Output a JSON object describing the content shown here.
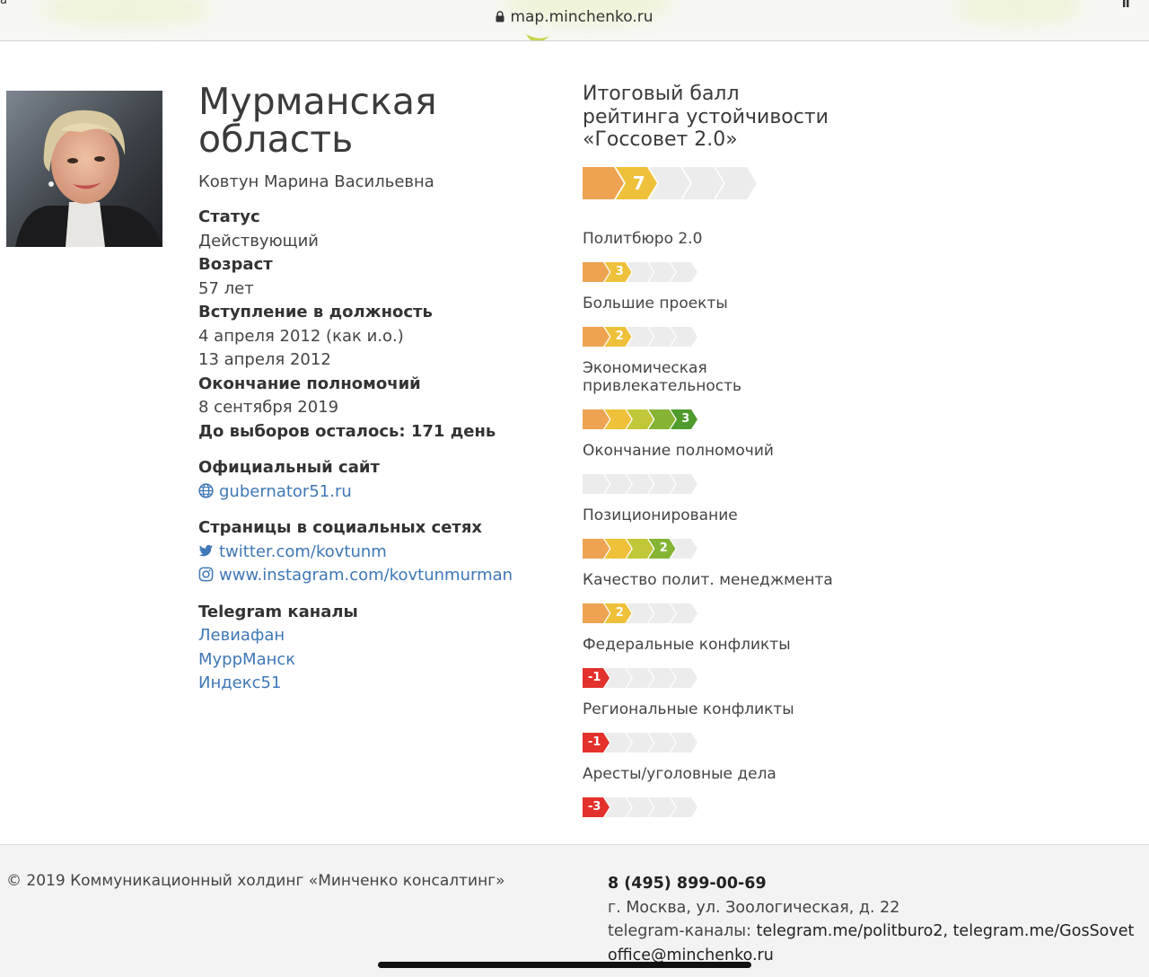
{
  "browser": {
    "url": "map.minchenko.ru",
    "stray_char": "a"
  },
  "profile": {
    "region": "Мурманская область",
    "governor": "Ковтун Марина Васильевна",
    "status_label": "Статус",
    "status_value": "Действующий",
    "age_label": "Возраст",
    "age_value": "57 лет",
    "start_label": "Вступление в должность",
    "start_value_1": "4 апреля 2012 (как и.о.)",
    "start_value_2": "13 апреля 2012",
    "end_label": "Окончание полномочий",
    "end_value": "8 сентября 2019",
    "election_countdown": "До выборов осталось: 171 день",
    "site_label": "Официальный сайт",
    "site_link": "gubernator51.ru",
    "social_label": "Страницы в социальных сетях",
    "twitter_link": "twitter.com/kovtunm",
    "instagram_link": "www.instagram.com/kovtunmurman",
    "telegram_label": "Telegram каналы",
    "telegram_channels": [
      "Левиафан",
      "МуррМанск",
      "Индекс51"
    ]
  },
  "rating": {
    "title": "Итоговый балл рейтинга устойчивости «Госсовет 2.0»",
    "total": {
      "value": "7",
      "filled": 2,
      "of": 5
    },
    "categories": [
      {
        "label": "Политбюро 2.0",
        "value": "3",
        "filled": 2,
        "of": 5,
        "mode": "positive"
      },
      {
        "label": "Большие проекты",
        "value": "2",
        "filled": 2,
        "of": 5,
        "mode": "positive"
      },
      {
        "label": "Экономическая привлекательность",
        "value": "3",
        "filled": 5,
        "of": 5,
        "mode": "positive"
      },
      {
        "label": "Окончание полномочий",
        "value": "",
        "filled": 0,
        "of": 5,
        "mode": "positive"
      },
      {
        "label": "Позиционирование",
        "value": "2",
        "filled": 4,
        "of": 5,
        "mode": "positive"
      },
      {
        "label": "Качество полит. менеджмента",
        "value": "2",
        "filled": 2,
        "of": 5,
        "mode": "positive"
      },
      {
        "label": "Федеральные конфликты",
        "value": "-1",
        "filled": 1,
        "of": 5,
        "mode": "negative"
      },
      {
        "label": "Региональные конфликты",
        "value": "-1",
        "filled": 1,
        "of": 5,
        "mode": "negative"
      },
      {
        "label": "Аресты/уголовные дела",
        "value": "-3",
        "filled": 1,
        "of": 5,
        "mode": "negative"
      }
    ],
    "colors": {
      "empty": "#ececec",
      "steps": [
        "#eda352",
        "#efc13a",
        "#c2c73a",
        "#86b435",
        "#4f9b2c"
      ],
      "negative": "#e3312b"
    }
  },
  "footer": {
    "copyright": "© 2019 Коммуникационный холдинг «Минченко консалтинг»",
    "phone": "8 (495) 899-00-69",
    "address": "г. Москва, ул. Зоологическая, д. 22",
    "telegram_prefix": "telegram-каналы:",
    "telegram_links": "telegram.me/politburo2, telegram.me/GosSovet",
    "email": "office@minchenko.ru"
  }
}
